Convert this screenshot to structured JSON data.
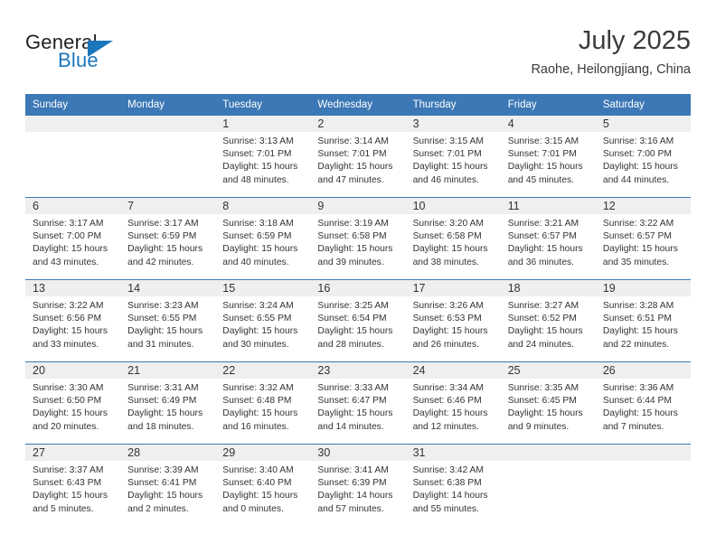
{
  "brand": {
    "name_part1": "General",
    "name_part2": "Blue",
    "triangle_color": "#1b76bc",
    "logo_icon": "triangle-icon"
  },
  "header": {
    "month_title": "July 2025",
    "location": "Raohe, Heilongjiang, China"
  },
  "colors": {
    "header_blue": "#3c78b5",
    "daynum_band": "#efefef",
    "text": "#333333",
    "brand_blue": "#1b76bc"
  },
  "weekday_headers": [
    "Sunday",
    "Monday",
    "Tuesday",
    "Wednesday",
    "Thursday",
    "Friday",
    "Saturday"
  ],
  "labels": {
    "sunrise_prefix": "Sunrise:",
    "sunset_prefix": "Sunset:",
    "daylight_prefix": "Daylight:"
  },
  "weeks": [
    [
      {
        "day": "",
        "sunrise": "",
        "sunset": "",
        "daylight_line1": "",
        "daylight_line2": ""
      },
      {
        "day": "",
        "sunrise": "",
        "sunset": "",
        "daylight_line1": "",
        "daylight_line2": ""
      },
      {
        "day": "1",
        "sunrise": "Sunrise: 3:13 AM",
        "sunset": "Sunset: 7:01 PM",
        "daylight_line1": "Daylight: 15 hours",
        "daylight_line2": "and 48 minutes."
      },
      {
        "day": "2",
        "sunrise": "Sunrise: 3:14 AM",
        "sunset": "Sunset: 7:01 PM",
        "daylight_line1": "Daylight: 15 hours",
        "daylight_line2": "and 47 minutes."
      },
      {
        "day": "3",
        "sunrise": "Sunrise: 3:15 AM",
        "sunset": "Sunset: 7:01 PM",
        "daylight_line1": "Daylight: 15 hours",
        "daylight_line2": "and 46 minutes."
      },
      {
        "day": "4",
        "sunrise": "Sunrise: 3:15 AM",
        "sunset": "Sunset: 7:01 PM",
        "daylight_line1": "Daylight: 15 hours",
        "daylight_line2": "and 45 minutes."
      },
      {
        "day": "5",
        "sunrise": "Sunrise: 3:16 AM",
        "sunset": "Sunset: 7:00 PM",
        "daylight_line1": "Daylight: 15 hours",
        "daylight_line2": "and 44 minutes."
      }
    ],
    [
      {
        "day": "6",
        "sunrise": "Sunrise: 3:17 AM",
        "sunset": "Sunset: 7:00 PM",
        "daylight_line1": "Daylight: 15 hours",
        "daylight_line2": "and 43 minutes."
      },
      {
        "day": "7",
        "sunrise": "Sunrise: 3:17 AM",
        "sunset": "Sunset: 6:59 PM",
        "daylight_line1": "Daylight: 15 hours",
        "daylight_line2": "and 42 minutes."
      },
      {
        "day": "8",
        "sunrise": "Sunrise: 3:18 AM",
        "sunset": "Sunset: 6:59 PM",
        "daylight_line1": "Daylight: 15 hours",
        "daylight_line2": "and 40 minutes."
      },
      {
        "day": "9",
        "sunrise": "Sunrise: 3:19 AM",
        "sunset": "Sunset: 6:58 PM",
        "daylight_line1": "Daylight: 15 hours",
        "daylight_line2": "and 39 minutes."
      },
      {
        "day": "10",
        "sunrise": "Sunrise: 3:20 AM",
        "sunset": "Sunset: 6:58 PM",
        "daylight_line1": "Daylight: 15 hours",
        "daylight_line2": "and 38 minutes."
      },
      {
        "day": "11",
        "sunrise": "Sunrise: 3:21 AM",
        "sunset": "Sunset: 6:57 PM",
        "daylight_line1": "Daylight: 15 hours",
        "daylight_line2": "and 36 minutes."
      },
      {
        "day": "12",
        "sunrise": "Sunrise: 3:22 AM",
        "sunset": "Sunset: 6:57 PM",
        "daylight_line1": "Daylight: 15 hours",
        "daylight_line2": "and 35 minutes."
      }
    ],
    [
      {
        "day": "13",
        "sunrise": "Sunrise: 3:22 AM",
        "sunset": "Sunset: 6:56 PM",
        "daylight_line1": "Daylight: 15 hours",
        "daylight_line2": "and 33 minutes."
      },
      {
        "day": "14",
        "sunrise": "Sunrise: 3:23 AM",
        "sunset": "Sunset: 6:55 PM",
        "daylight_line1": "Daylight: 15 hours",
        "daylight_line2": "and 31 minutes."
      },
      {
        "day": "15",
        "sunrise": "Sunrise: 3:24 AM",
        "sunset": "Sunset: 6:55 PM",
        "daylight_line1": "Daylight: 15 hours",
        "daylight_line2": "and 30 minutes."
      },
      {
        "day": "16",
        "sunrise": "Sunrise: 3:25 AM",
        "sunset": "Sunset: 6:54 PM",
        "daylight_line1": "Daylight: 15 hours",
        "daylight_line2": "and 28 minutes."
      },
      {
        "day": "17",
        "sunrise": "Sunrise: 3:26 AM",
        "sunset": "Sunset: 6:53 PM",
        "daylight_line1": "Daylight: 15 hours",
        "daylight_line2": "and 26 minutes."
      },
      {
        "day": "18",
        "sunrise": "Sunrise: 3:27 AM",
        "sunset": "Sunset: 6:52 PM",
        "daylight_line1": "Daylight: 15 hours",
        "daylight_line2": "and 24 minutes."
      },
      {
        "day": "19",
        "sunrise": "Sunrise: 3:28 AM",
        "sunset": "Sunset: 6:51 PM",
        "daylight_line1": "Daylight: 15 hours",
        "daylight_line2": "and 22 minutes."
      }
    ],
    [
      {
        "day": "20",
        "sunrise": "Sunrise: 3:30 AM",
        "sunset": "Sunset: 6:50 PM",
        "daylight_line1": "Daylight: 15 hours",
        "daylight_line2": "and 20 minutes."
      },
      {
        "day": "21",
        "sunrise": "Sunrise: 3:31 AM",
        "sunset": "Sunset: 6:49 PM",
        "daylight_line1": "Daylight: 15 hours",
        "daylight_line2": "and 18 minutes."
      },
      {
        "day": "22",
        "sunrise": "Sunrise: 3:32 AM",
        "sunset": "Sunset: 6:48 PM",
        "daylight_line1": "Daylight: 15 hours",
        "daylight_line2": "and 16 minutes."
      },
      {
        "day": "23",
        "sunrise": "Sunrise: 3:33 AM",
        "sunset": "Sunset: 6:47 PM",
        "daylight_line1": "Daylight: 15 hours",
        "daylight_line2": "and 14 minutes."
      },
      {
        "day": "24",
        "sunrise": "Sunrise: 3:34 AM",
        "sunset": "Sunset: 6:46 PM",
        "daylight_line1": "Daylight: 15 hours",
        "daylight_line2": "and 12 minutes."
      },
      {
        "day": "25",
        "sunrise": "Sunrise: 3:35 AM",
        "sunset": "Sunset: 6:45 PM",
        "daylight_line1": "Daylight: 15 hours",
        "daylight_line2": "and 9 minutes."
      },
      {
        "day": "26",
        "sunrise": "Sunrise: 3:36 AM",
        "sunset": "Sunset: 6:44 PM",
        "daylight_line1": "Daylight: 15 hours",
        "daylight_line2": "and 7 minutes."
      }
    ],
    [
      {
        "day": "27",
        "sunrise": "Sunrise: 3:37 AM",
        "sunset": "Sunset: 6:43 PM",
        "daylight_line1": "Daylight: 15 hours",
        "daylight_line2": "and 5 minutes."
      },
      {
        "day": "28",
        "sunrise": "Sunrise: 3:39 AM",
        "sunset": "Sunset: 6:41 PM",
        "daylight_line1": "Daylight: 15 hours",
        "daylight_line2": "and 2 minutes."
      },
      {
        "day": "29",
        "sunrise": "Sunrise: 3:40 AM",
        "sunset": "Sunset: 6:40 PM",
        "daylight_line1": "Daylight: 15 hours",
        "daylight_line2": "and 0 minutes."
      },
      {
        "day": "30",
        "sunrise": "Sunrise: 3:41 AM",
        "sunset": "Sunset: 6:39 PM",
        "daylight_line1": "Daylight: 14 hours",
        "daylight_line2": "and 57 minutes."
      },
      {
        "day": "31",
        "sunrise": "Sunrise: 3:42 AM",
        "sunset": "Sunset: 6:38 PM",
        "daylight_line1": "Daylight: 14 hours",
        "daylight_line2": "and 55 minutes."
      },
      {
        "day": "",
        "sunrise": "",
        "sunset": "",
        "daylight_line1": "",
        "daylight_line2": ""
      },
      {
        "day": "",
        "sunrise": "",
        "sunset": "",
        "daylight_line1": "",
        "daylight_line2": ""
      }
    ]
  ]
}
